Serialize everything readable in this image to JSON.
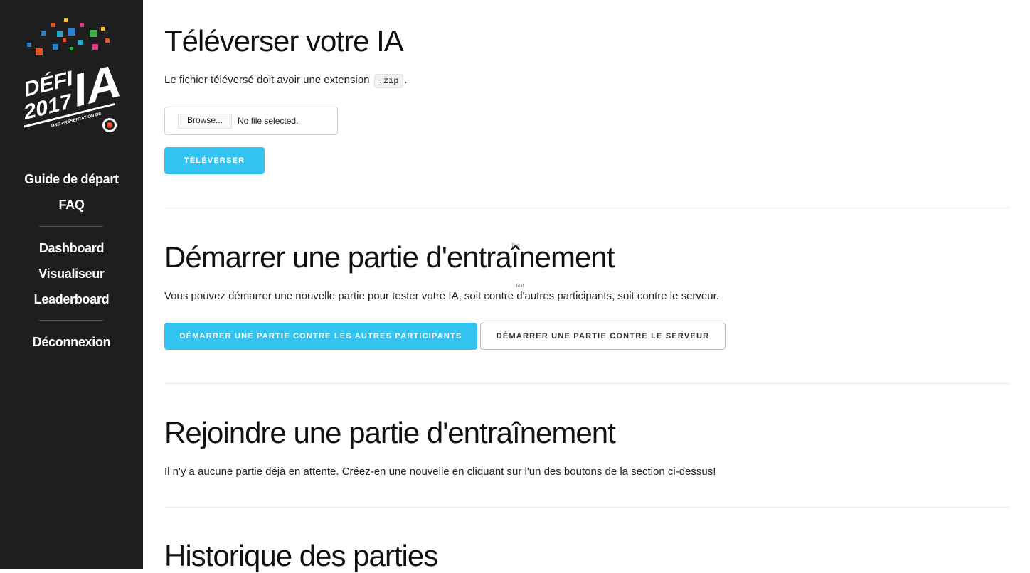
{
  "sidebar": {
    "logo": {
      "line1": "DÉFI",
      "line2": "2017",
      "big": "IA",
      "tagline": "UNE PRÉSENTATION DE"
    },
    "nav_primary": [
      {
        "label": "Guide de départ"
      },
      {
        "label": "FAQ"
      }
    ],
    "nav_secondary": [
      {
        "label": "Dashboard"
      },
      {
        "label": "Visualiseur"
      },
      {
        "label": "Leaderboard"
      }
    ],
    "nav_account": [
      {
        "label": "Déconnexion"
      }
    ]
  },
  "upload": {
    "title": "Téléverser votre IA",
    "desc_before": "Le fichier téléversé doit avoir une extension",
    "desc_code": ".zip",
    "desc_after": ".",
    "browse_label": "Browse...",
    "file_status": "No file selected.",
    "submit_label": "TÉLÉVERSER"
  },
  "start_game": {
    "title": "Démarrer une partie d'entraînement",
    "desc": "Vous pouvez démarrer une nouvelle partie pour tester votre IA, soit contre d'autres participants, soit contre le serveur.",
    "btn_vs_participants": "DÉMARRER UNE PARTIE CONTRE LES AUTRES PARTICIPANTS",
    "btn_vs_server": "DÉMARRER UNE PARTIE CONTRE LE SERVEUR",
    "stray_labels": [
      "Text",
      "Text"
    ]
  },
  "join_game": {
    "title": "Rejoindre une partie d'entraînement",
    "desc": "Il n'y a aucune partie déjà en attente. Créez-en une nouvelle en cliquant sur l'un des boutons de la section ci-dessus!"
  },
  "history": {
    "title": "Historique des parties"
  },
  "colors": {
    "sidebar_bg": "#1e1e1e",
    "accent": "#33c3f0",
    "logo_confetti": [
      "#e8542c",
      "#2b7fd4",
      "#3fae49",
      "#f2c12e",
      "#e23b8c",
      "#21a6c9"
    ]
  }
}
